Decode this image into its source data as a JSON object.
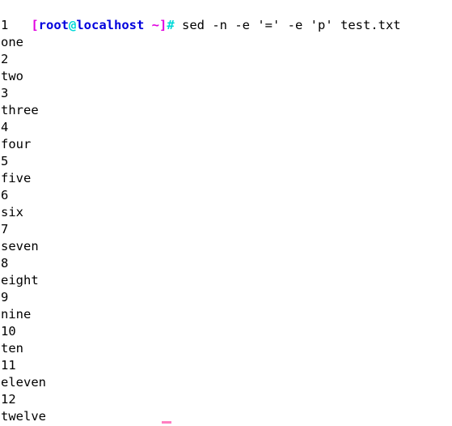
{
  "terminal": {
    "background_color": "#ffffff",
    "foreground_color": "#000000",
    "prompt": {
      "open_bracket": "[",
      "user": "root",
      "at": "@",
      "host": "localhost",
      "path_and_close": " ~]",
      "sigil": "#",
      "colors": {
        "bracket": "#e000e0",
        "user": "#0000dd",
        "at": "#00d8d8",
        "host": "#0000dd",
        "tilde": "#e000e0",
        "sigil": "#00d8d8"
      }
    },
    "command": " sed -n -e '=' -e 'p' test.txt",
    "output_lines": [
      "1",
      "one",
      "2",
      "two",
      "3",
      "three",
      "4",
      "four",
      "5",
      "five",
      "6",
      "six",
      "7",
      "seven",
      "8",
      "eight",
      "9",
      "nine",
      "10",
      "ten",
      "11",
      "eleven",
      "12",
      "twelve"
    ],
    "cursor": {
      "color": "#ff7ec0",
      "visible": true
    }
  }
}
